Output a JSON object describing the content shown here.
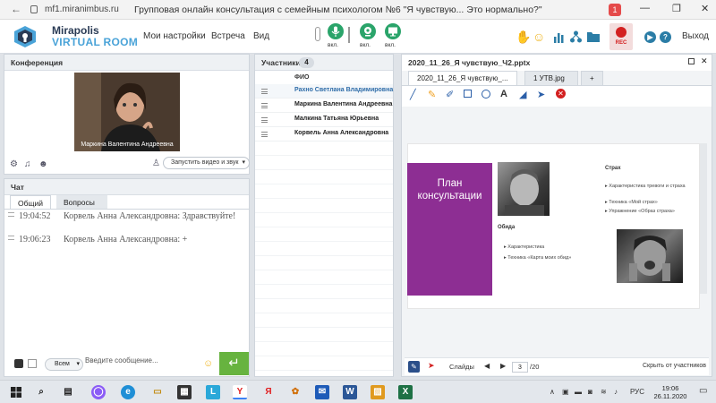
{
  "browser": {
    "url": "mf1.miranimbus.ru",
    "title": "Групповая онлайн консультация с семейным психологом №6 \"Я чувствую... Это нормально?\"",
    "notification_count": "1",
    "window_buttons": [
      "—",
      "❐",
      "✕"
    ]
  },
  "header": {
    "logo_line1": "Mirapolis",
    "logo_line2": "VIRTUAL ROOM",
    "menu": [
      "Мои настройки",
      "Встреча",
      "Вид"
    ],
    "mic_label": "вкл.",
    "cam_label": "вкл.",
    "screen_label": "вкл.",
    "rec_label": "REC",
    "exit_label": "Выход",
    "colors": {
      "green": "#2aa46a",
      "rec": "#d32020",
      "brand": "#4aa3d8"
    }
  },
  "conference": {
    "title": "Конференция",
    "video_name": "Маркина Валентина  Андреевна",
    "start_video_label": "Запустить видео и звук"
  },
  "chat": {
    "title": "Чат",
    "tabs": [
      "Общий",
      "Вопросы"
    ],
    "messages": [
      {
        "time": "19:04:52",
        "text": "Корвель Анна  Александровна: Здравствуйте!"
      },
      {
        "time": "19:06:23",
        "text": "Корвель Анна  Александровна: +"
      }
    ],
    "audience": "Всем",
    "input_placeholder": "Введите сообщение..."
  },
  "participants": {
    "title": "Участники",
    "count": "4",
    "column": "ФИО",
    "rows": [
      {
        "name": "Рахно Светлана  Владимировна",
        "highlight": true
      },
      {
        "name": "Маркина Валентина  Андреевна",
        "highlight": false
      },
      {
        "name": "Малкина Татьяна  Юрьевна",
        "highlight": false
      },
      {
        "name": "Корвель Анна  Александровна",
        "highlight": false
      }
    ]
  },
  "presentation": {
    "title": "2020_11_26_Я чувствую_Ч2.pptx",
    "tabs": [
      "2020_11_26_Я чувствую_...",
      "1 УТВ.jpg",
      "+"
    ],
    "slide": {
      "plan_title": "План консультации",
      "heading_fear": "Страх",
      "fear_items": [
        "Характеристика тревоги и страха",
        "Техника «Мой страх»",
        "Упражнение «Образ страха»"
      ],
      "heading_offense": "Обида",
      "offense_items": [
        "Характеристика",
        "Техника «Карта моих обид»"
      ]
    },
    "slides_label": "Слайды",
    "current_page": "3",
    "total_pages": "/20",
    "hide_label": "Скрыть от участников"
  },
  "taskbar": {
    "lang": "РУС",
    "time": "19:06",
    "date": "26.11.2020"
  }
}
